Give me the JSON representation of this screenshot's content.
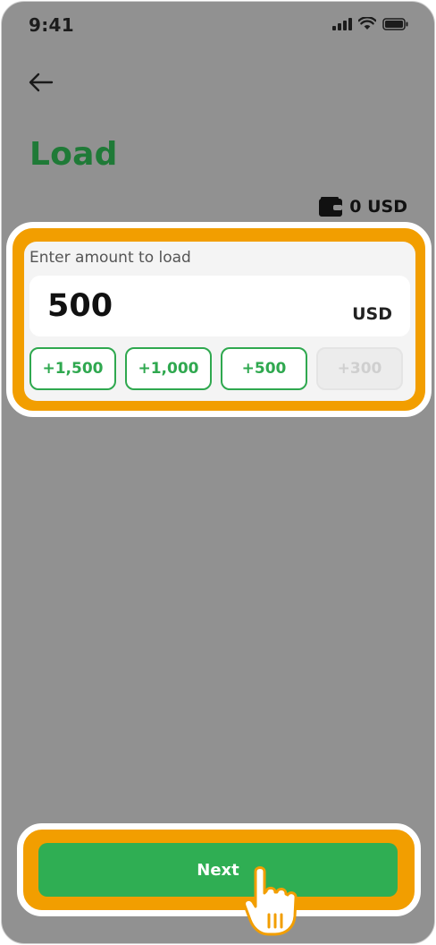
{
  "status_bar": {
    "time": "9:41",
    "icons": [
      "signal-icon",
      "wifi-icon",
      "battery-icon"
    ]
  },
  "header": {
    "back_icon": "arrow-left-icon",
    "title": "Load"
  },
  "balance": {
    "icon": "wallet-icon",
    "text": "0 USD"
  },
  "amount_card": {
    "label": "Enter amount to load",
    "value": "500",
    "currency": "USD",
    "quick_amounts": [
      {
        "label": "+1,500",
        "enabled": true
      },
      {
        "label": "+1,000",
        "enabled": true
      },
      {
        "label": "+500",
        "enabled": true
      },
      {
        "label": "+300",
        "enabled": false
      }
    ]
  },
  "next_button": {
    "label": "Next"
  },
  "pointer_icon": "hand-pointer-icon",
  "colors": {
    "background_overlay": "#919191",
    "title_green": "#1f7a37",
    "accent_green": "#2fae53",
    "highlight_orange": "#f29e00",
    "chip_border": "#2fa84f"
  }
}
